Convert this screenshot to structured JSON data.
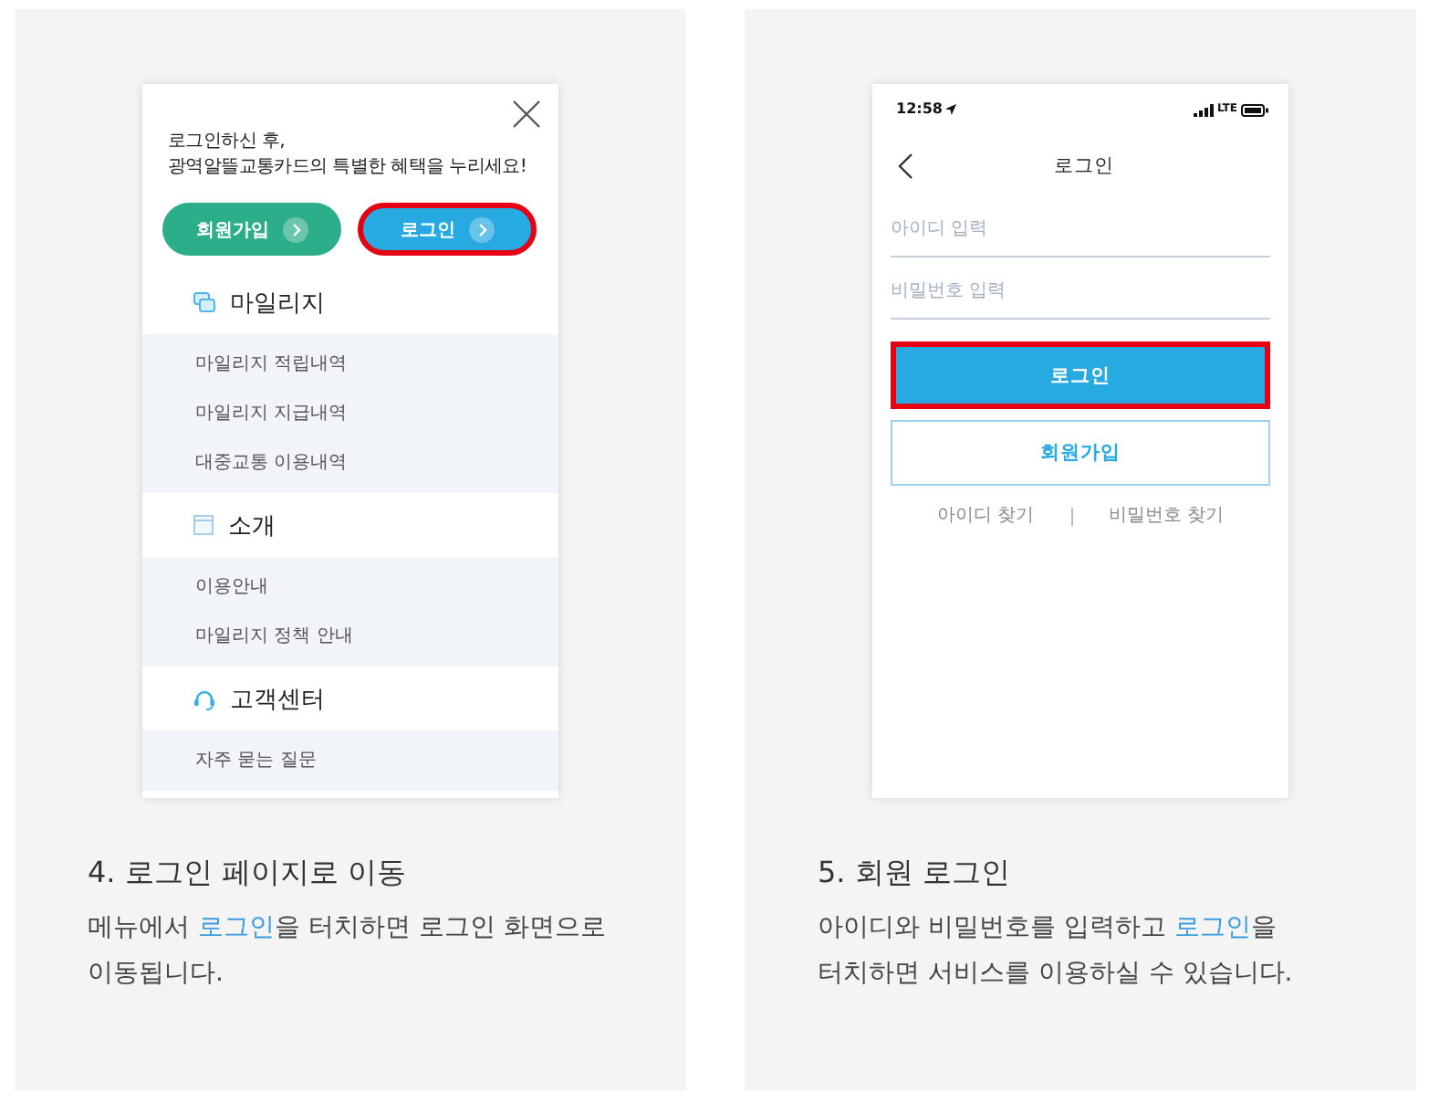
{
  "panels": [
    {
      "screen": {
        "kind": "menu",
        "greeting": [
          "로그인하신 후,",
          "광역알뜰교통카드의 특별한 혜택을 누리세요!"
        ],
        "buttons": [
          {
            "label": "회원가입",
            "color": "#2dae8a",
            "highlighted": false
          },
          {
            "label": "로그인",
            "color": "#27a9e1",
            "highlighted": true
          }
        ],
        "sections": [
          {
            "title": "마일리지",
            "items": [
              "마일리지 적립내역",
              "마일리지 지급내역",
              "대중교통 이용내역"
            ]
          },
          {
            "title": "소개",
            "items": [
              "이용안내",
              "마일리지 정책 안내"
            ]
          },
          {
            "title": "고객센터",
            "items": [
              "자주 묻는 질문"
            ]
          }
        ]
      },
      "caption": {
        "title": "4. 로그인 페이지로 이동",
        "description": [
          {
            "text": "메뉴에서 ",
            "highlight": false
          },
          {
            "text": "로그인",
            "highlight": true
          },
          {
            "text": "을 터치하면 로그인 화면으로 이동됩니다.",
            "highlight": false
          }
        ]
      }
    },
    {
      "screen": {
        "kind": "login",
        "status_bar": {
          "time": "12:58",
          "network": "LTE"
        },
        "title": "로그인",
        "fields": [
          {
            "placeholder": "아이디 입력"
          },
          {
            "placeholder": "비밀번호 입력"
          }
        ],
        "buttons": [
          {
            "label": "로그인",
            "kind": "filled",
            "highlighted": true
          },
          {
            "label": "회원가입",
            "kind": "outline",
            "highlighted": false
          }
        ],
        "links": [
          "아이디 찾기",
          "비밀번호 찾기"
        ]
      },
      "caption": {
        "title": "5. 회원 로그인",
        "description": [
          {
            "text": "아이디와 비밀번호를 입력하고 ",
            "highlight": false
          },
          {
            "text": "로그인",
            "highlight": true
          },
          {
            "text": "을 터치하면 서비스를 이용하실 수 있습니다.",
            "highlight": false
          }
        ]
      }
    }
  ]
}
